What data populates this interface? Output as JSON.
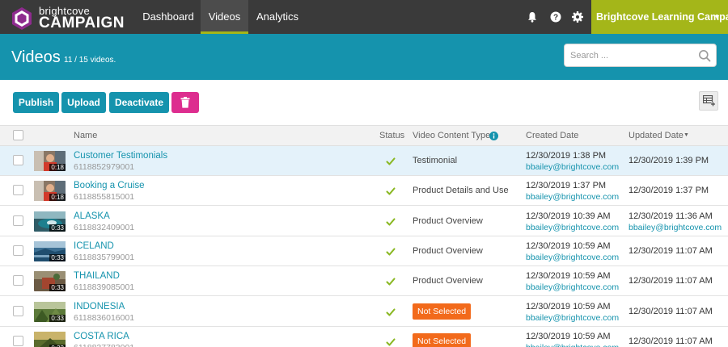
{
  "brand": {
    "small": "brightcove",
    "big": "CAMPAIGN"
  },
  "nav": {
    "tabs": [
      "Dashboard",
      "Videos",
      "Analytics"
    ],
    "active": "Videos"
  },
  "account": {
    "label": "Brightcove Learning Campaign",
    "caret": "▼"
  },
  "header": {
    "title": "Videos",
    "count": "11 / 15 videos."
  },
  "search": {
    "placeholder": "Search ..."
  },
  "toolbar": {
    "publish": "Publish",
    "upload": "Upload",
    "deactivate": "Deactivate"
  },
  "table": {
    "columns": {
      "name": "Name",
      "status": "Status",
      "content_type": "Video Content Type",
      "created": "Created Date",
      "updated": "Updated Date",
      "sort_indicator": "▼"
    },
    "rows": [
      {
        "name": "Customer Testimonials",
        "id": "6118852979001",
        "duration": "0:18",
        "content_type": "Testimonial",
        "not_selected": false,
        "created": "12/30/2019 1:38 PM",
        "created_by": "bbailey@brightcove.com",
        "updated": "12/30/2019 1:39 PM",
        "updated_by": "",
        "selected": true,
        "thumb": "testimonial"
      },
      {
        "name": "Booking a Cruise",
        "id": "6118855815001",
        "duration": "0:18",
        "content_type": "Product Details and Use",
        "not_selected": false,
        "created": "12/30/2019 1:37 PM",
        "created_by": "bbailey@brightcove.com",
        "updated": "12/30/2019 1:37 PM",
        "updated_by": "",
        "selected": false,
        "thumb": "testimonial"
      },
      {
        "name": "ALASKA",
        "id": "6118832409001",
        "duration": "0:33",
        "content_type": "Product Overview",
        "not_selected": false,
        "created": "12/30/2019 10:39 AM",
        "created_by": "bbailey@brightcove.com",
        "updated": "12/30/2019 11:36 AM",
        "updated_by": "bbailey@brightcove.com",
        "selected": false,
        "thumb": "alaska"
      },
      {
        "name": "ICELAND",
        "id": "6118835799001",
        "duration": "0:33",
        "content_type": "Product Overview",
        "not_selected": false,
        "created": "12/30/2019 10:59 AM",
        "created_by": "bbailey@brightcove.com",
        "updated": "12/30/2019 11:07 AM",
        "updated_by": "",
        "selected": false,
        "thumb": "iceland"
      },
      {
        "name": "THAILAND",
        "id": "6118839085001",
        "duration": "0:33",
        "content_type": "Product Overview",
        "not_selected": false,
        "created": "12/30/2019 10:59 AM",
        "created_by": "bbailey@brightcove.com",
        "updated": "12/30/2019 11:07 AM",
        "updated_by": "",
        "selected": false,
        "thumb": "thailand"
      },
      {
        "name": "INDONESIA",
        "id": "6118836016001",
        "duration": "0:33",
        "content_type": "Not Selected",
        "not_selected": true,
        "created": "12/30/2019 10:59 AM",
        "created_by": "bbailey@brightcove.com",
        "updated": "12/30/2019 11:07 AM",
        "updated_by": "",
        "selected": false,
        "thumb": "indonesia"
      },
      {
        "name": "COSTA RICA",
        "id": "6118837783001",
        "duration": "0:33",
        "content_type": "Not Selected",
        "not_selected": true,
        "created": "12/30/2019 10:59 AM",
        "created_by": "bbailey@brightcove.com",
        "updated": "12/30/2019 11:07 AM",
        "updated_by": "",
        "selected": false,
        "thumb": "costarica"
      }
    ]
  },
  "colors": {
    "nav_bg": "#3a3a3a",
    "accent_green": "#a4b619",
    "teal": "#1593ad",
    "magenta": "#dd2d8f",
    "orange": "#f26a1b",
    "check_green": "#8ab823"
  },
  "icons": [
    "brightcove-logo-icon",
    "bell-icon",
    "help-icon",
    "gear-icon",
    "search-icon",
    "trash-icon",
    "table-settings-icon",
    "info-icon",
    "check-icon"
  ]
}
